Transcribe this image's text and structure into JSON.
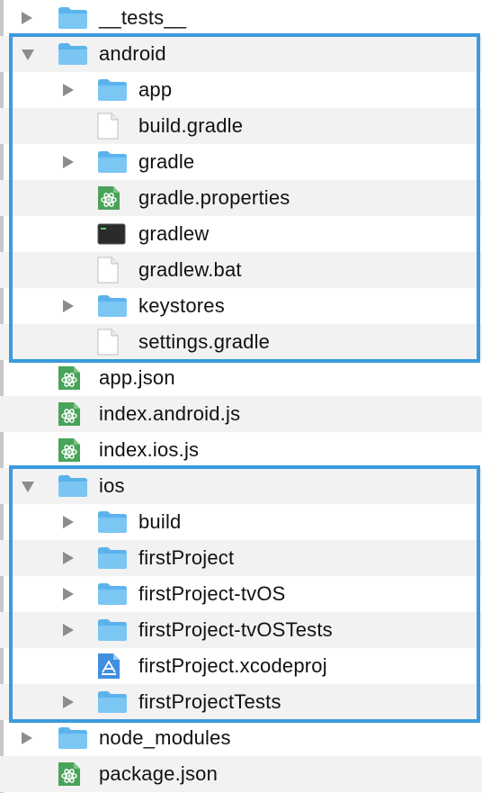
{
  "tree": {
    "rows": [
      {
        "label": "__tests__",
        "kind": "folder",
        "level": 0,
        "disclosure": "closed"
      },
      {
        "label": "android",
        "kind": "folder",
        "level": 0,
        "disclosure": "open"
      },
      {
        "label": "app",
        "kind": "folder",
        "level": 1,
        "disclosure": "closed"
      },
      {
        "label": "build.gradle",
        "kind": "document",
        "level": 1,
        "disclosure": "none"
      },
      {
        "label": "gradle",
        "kind": "folder",
        "level": 1,
        "disclosure": "closed"
      },
      {
        "label": "gradle.properties",
        "kind": "atom",
        "level": 1,
        "disclosure": "none"
      },
      {
        "label": "gradlew",
        "kind": "terminal",
        "level": 1,
        "disclosure": "none"
      },
      {
        "label": "gradlew.bat",
        "kind": "document",
        "level": 1,
        "disclosure": "none"
      },
      {
        "label": "keystores",
        "kind": "folder",
        "level": 1,
        "disclosure": "closed"
      },
      {
        "label": "settings.gradle",
        "kind": "document",
        "level": 1,
        "disclosure": "none"
      },
      {
        "label": "app.json",
        "kind": "atom",
        "level": 0,
        "disclosure": "none"
      },
      {
        "label": "index.android.js",
        "kind": "atom",
        "level": 0,
        "disclosure": "none"
      },
      {
        "label": "index.ios.js",
        "kind": "atom",
        "level": 0,
        "disclosure": "none"
      },
      {
        "label": "ios",
        "kind": "folder",
        "level": 0,
        "disclosure": "open"
      },
      {
        "label": "build",
        "kind": "folder",
        "level": 1,
        "disclosure": "closed"
      },
      {
        "label": "firstProject",
        "kind": "folder",
        "level": 1,
        "disclosure": "closed"
      },
      {
        "label": "firstProject-tvOS",
        "kind": "folder",
        "level": 1,
        "disclosure": "closed"
      },
      {
        "label": "firstProject-tvOSTests",
        "kind": "folder",
        "level": 1,
        "disclosure": "closed"
      },
      {
        "label": "firstProject.xcodeproj",
        "kind": "xcode",
        "level": 1,
        "disclosure": "none"
      },
      {
        "label": "firstProjectTests",
        "kind": "folder",
        "level": 1,
        "disclosure": "closed"
      },
      {
        "label": "node_modules",
        "kind": "folder",
        "level": 0,
        "disclosure": "closed"
      },
      {
        "label": "package.json",
        "kind": "atom",
        "level": 0,
        "disclosure": "none"
      }
    ],
    "highlight_groups": [
      {
        "name": "android",
        "first_row": 1,
        "last_row": 9
      },
      {
        "name": "ios",
        "first_row": 13,
        "last_row": 19
      }
    ]
  },
  "colors": {
    "highlight_border": "#3b9bdc",
    "folder_body": "#7cc6f4",
    "folder_tab": "#5bb3ec",
    "atom_green": "#4aa35a",
    "row_alt": "#f2f2f2"
  }
}
